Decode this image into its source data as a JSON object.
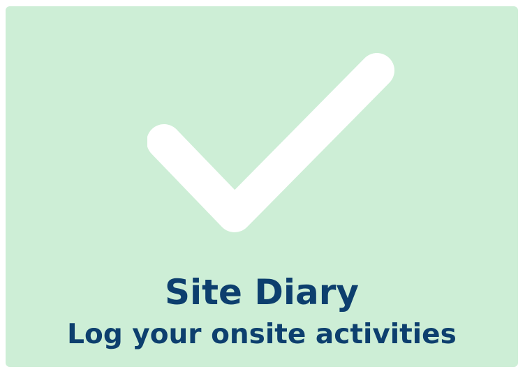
{
  "tile": {
    "icon": "checkmark-icon",
    "title": "Site Diary",
    "subtitle": "Log your onsite activities"
  },
  "colors": {
    "tile_background": "#cdeed6",
    "text": "#0d3f6e",
    "icon": "#ffffff"
  }
}
